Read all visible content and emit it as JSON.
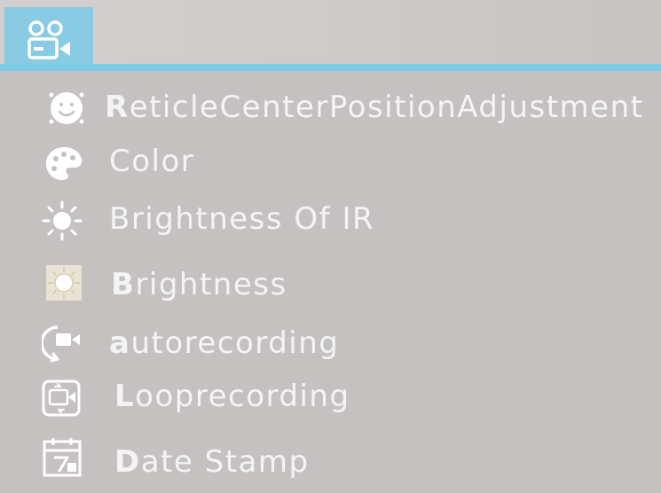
{
  "header": {
    "tab_icon": "video-camera-icon",
    "accent_color": "#7dcbe6"
  },
  "menu": {
    "items": [
      {
        "first": "R",
        "rest": "eticleCenterPositionAdjustment",
        "icon": "smiley-face-icon"
      },
      {
        "first": "",
        "rest": "Color",
        "icon": "palette-icon"
      },
      {
        "first": "",
        "rest": "Brightness Of IR",
        "icon": "sun-icon"
      },
      {
        "first": "B",
        "rest": "rightness",
        "icon": "brightness-frame-icon"
      },
      {
        "first": "a",
        "rest": "utorecording",
        "icon": "autorecording-icon"
      },
      {
        "first": "L",
        "rest": "ooprecording",
        "icon": "looprecording-icon"
      },
      {
        "first": "D",
        "rest": "ate Stamp",
        "icon": "date-stamp-icon"
      }
    ]
  }
}
